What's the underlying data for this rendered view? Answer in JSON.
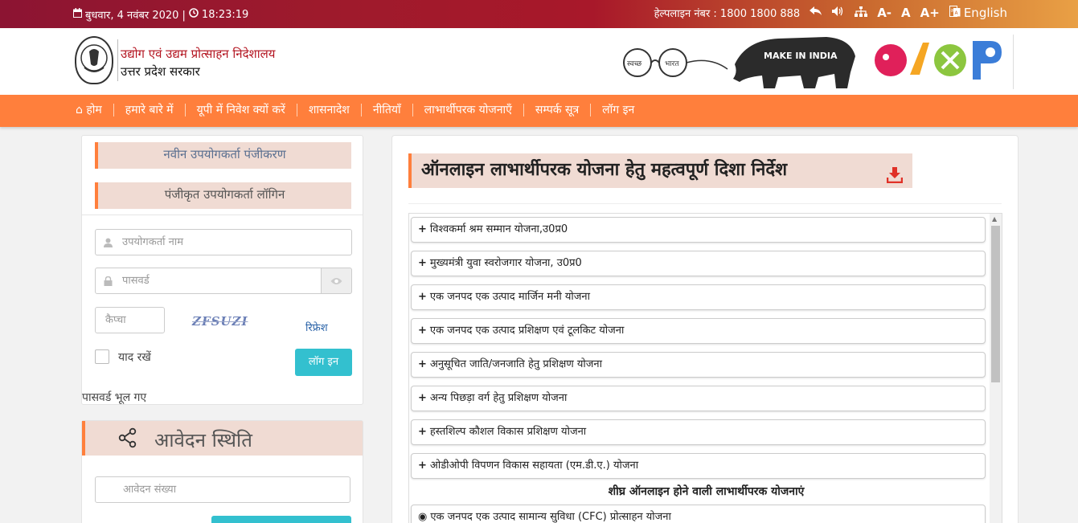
{
  "topbar": {
    "date": "बुधवार, 4 नवंबर 2020 |",
    "time": "18:23:19",
    "helpline_label": "हेल्पलाइन नंबर : 1800 1800 888",
    "font_small": "A-",
    "font_normal": "A",
    "font_large": "A+",
    "language": "English",
    "icons": [
      "calendar-icon",
      "clock-icon",
      "back-icon",
      "sound-icon",
      "sitemap-icon",
      "translate-icon"
    ]
  },
  "header": {
    "org_name": "उद्योग एवं उद्यम प्रोत्साहन निदेशालय",
    "org_sub": "उत्तर प्रदेश सरकार",
    "swachh_left": "स्वच्छ",
    "swachh_right": "भारत",
    "make_in_india": "MAKE IN INDIA"
  },
  "nav": {
    "items": [
      "होम",
      "हमारे बारे में",
      "यूपी में निवेश क्यों करें",
      "शासनादेश",
      "नीतियाँ",
      "लाभार्थीपरक योजनाएँ",
      "सम्पर्क सूत्र",
      "लॉग इन"
    ]
  },
  "login": {
    "tab_register": "नवीन उपयोगकर्ता पंजीकरण",
    "tab_login": "पंजीकृत उपयोगकर्ता लॉगिन",
    "username_placeholder": "उपयोगकर्ता नाम",
    "password_placeholder": "पासवर्ड",
    "captcha_placeholder": "कैप्चा",
    "captcha_text": "ZFSUZI",
    "refresh": "रिफ्रेश",
    "remember": "याद रखें",
    "login_button": "लॉग इन",
    "forgot": "पासवर्ड भूल गए"
  },
  "status": {
    "title": "आवेदन स्थिति",
    "application_placeholder": "आवेदन संख्या"
  },
  "main": {
    "title": "ऑनलाइन लाभार्थीपरक योजना हेतु महत्वपूर्ण दिशा निर्देश",
    "schemes": [
      "विश्वकर्मा श्रम सम्मान योजना,उ0प्र0",
      "मुख्यमंत्री युवा स्वरोजगार योजना, उ0प्र0",
      "एक जनपद एक उत्पाद मार्जिन मनी योजना",
      "एक जनपद एक उत्पाद प्रशिक्षण एवं टूलकिट योजना",
      "अनुसूचित जाति/जनजाति हेतु प्रशिक्षण योजना",
      "अन्य पिछड़ा वर्ग हेतु प्रशिक्षण योजना",
      "हस्तशिल्प कौशल विकास प्रशिक्षण योजना",
      "ओडीओपी विपणन विकास सहायता (एम.डी.ए.) योजना"
    ],
    "upcoming_heading": "शीघ्र ऑनलाइन होने वाली लाभार्थीपरक योजनाएं",
    "upcoming_first": "एक जनपद एक उत्पाद सामान्य सुविधा (CFC) प्रोत्साहन योजना"
  },
  "colors": {
    "nav_orange": "#ff7f3c",
    "heading_bg": "#f0dbd3",
    "button_teal": "#33c0cf",
    "brand_red": "#b3131f"
  }
}
